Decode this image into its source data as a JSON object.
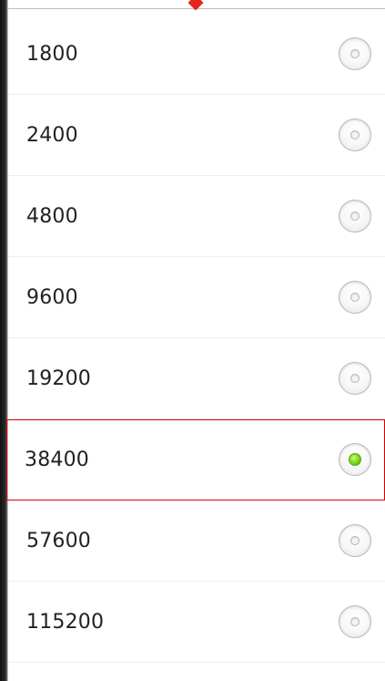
{
  "options": [
    {
      "label": "1800",
      "selected": false
    },
    {
      "label": "2400",
      "selected": false
    },
    {
      "label": "4800",
      "selected": false
    },
    {
      "label": "9600",
      "selected": false
    },
    {
      "label": "19200",
      "selected": false
    },
    {
      "label": "38400",
      "selected": true
    },
    {
      "label": "57600",
      "selected": false
    },
    {
      "label": "115200",
      "selected": false
    }
  ],
  "colors": {
    "selection_outline": "#d60000",
    "radio_checked": "#79d61a",
    "top_marker": "#e3261b"
  },
  "icons": {
    "radio_unchecked": "radio-unchecked-icon",
    "radio_checked": "radio-checked-icon"
  }
}
